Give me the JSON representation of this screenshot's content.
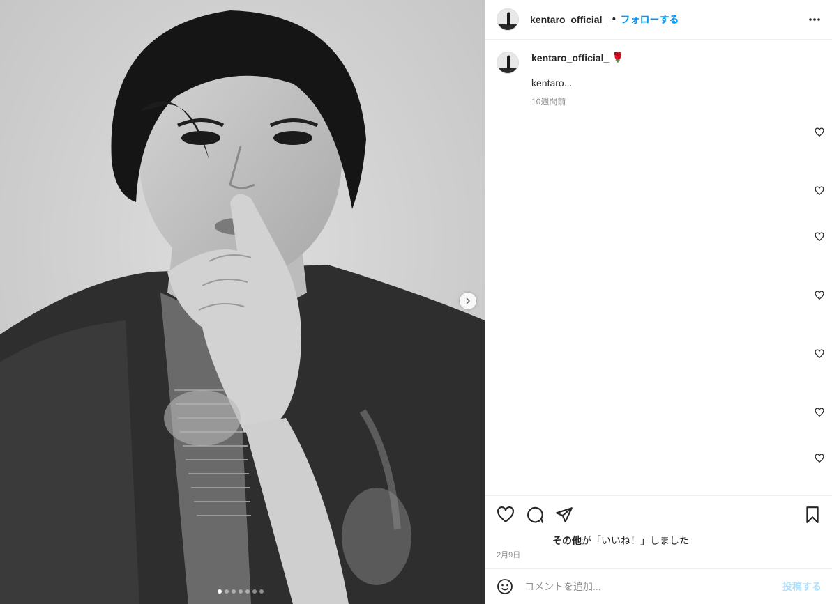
{
  "header": {
    "username": "kentaro_official_",
    "separator": "•",
    "follow_label": "フォローする",
    "more_icon": "more-horizontal-icon"
  },
  "caption": {
    "username": "kentaro_official_",
    "emoji": "🌹",
    "text": "kentaro...",
    "time": "10週間前"
  },
  "comments": {
    "heart_count": 7,
    "heart_icon": "heart-outline-icon"
  },
  "actions": {
    "like_icon": "heart-icon",
    "comment_icon": "comment-icon",
    "share_icon": "paper-plane-icon",
    "save_icon": "bookmark-icon"
  },
  "likes": {
    "bold": "その他",
    "text": "が「いいね！」しました"
  },
  "date": "2月9日",
  "comment_box": {
    "placeholder": "コメントを追加...",
    "post_label": "投稿する",
    "emoji_icon": "smiley-icon"
  },
  "carousel": {
    "dot_count": 7,
    "active_index": 0,
    "next_icon": "chevron-right-icon"
  },
  "colors": {
    "accent": "#0095f6",
    "post_disabled": "#b2dffc",
    "muted": "#8e8e8e",
    "border": "#efefef"
  }
}
